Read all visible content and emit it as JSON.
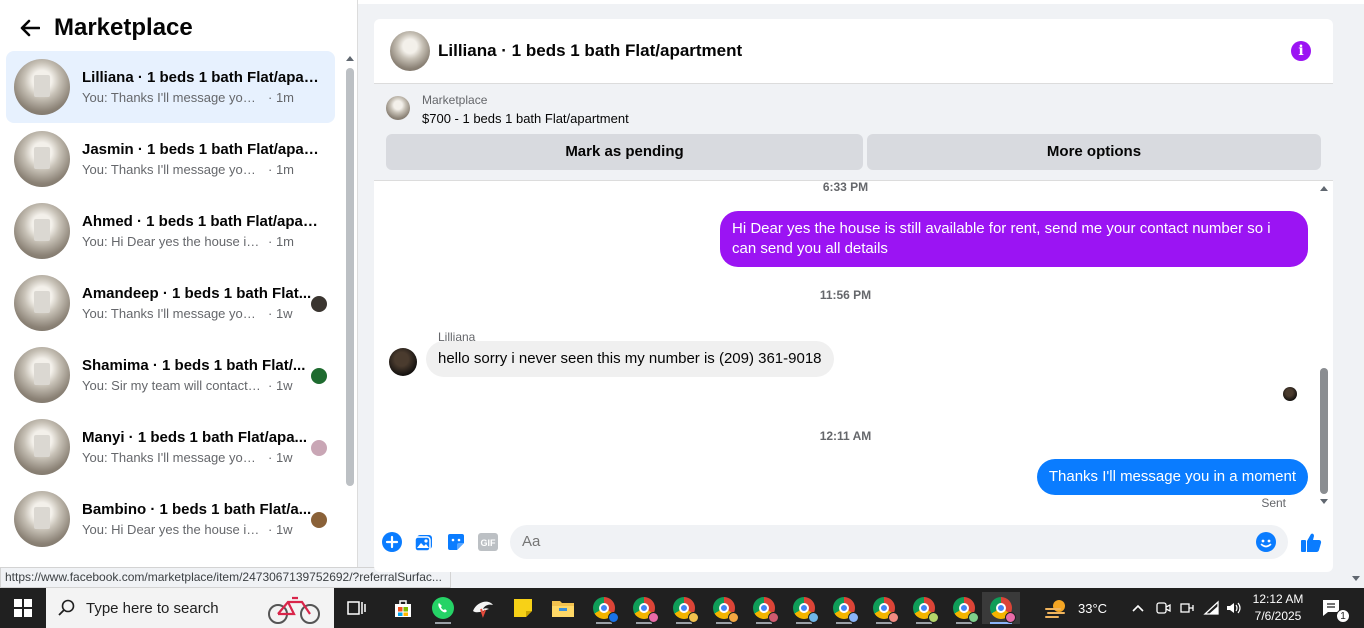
{
  "left_panel": {
    "title": "Marketplace",
    "conversations": [
      {
        "name": "Lilliana · 1 beds 1 bath Flat/apart...",
        "preview": "You: Thanks I'll message you in a ...",
        "time": "· 1m",
        "active": true,
        "mini_color": ""
      },
      {
        "name": "Jasmin · 1 beds 1 bath Flat/apart...",
        "preview": "You: Thanks I'll message you in a ...",
        "time": "· 1m",
        "active": false,
        "mini_color": ""
      },
      {
        "name": "Ahmed · 1 beds 1 bath Flat/apart...",
        "preview": "You: Hi Dear yes the house is still a...",
        "time": "· 1m",
        "active": false,
        "mini_color": ""
      },
      {
        "name": "Amandeep · 1 beds 1 bath Flat...",
        "preview": "You: Thanks I'll message you in ...",
        "time": "· 1w",
        "active": false,
        "mini_color": "#3a3530"
      },
      {
        "name": "Shamima · 1 beds 1 bath Flat/...",
        "preview": "You: Sir my team will contact yo...",
        "time": "· 1w",
        "active": false,
        "mini_color": "#1e6b2f"
      },
      {
        "name": "Manyi · 1 beds 1 bath Flat/apa...",
        "preview": "You: Thanks I'll message you in ...",
        "time": "· 1w",
        "active": false,
        "mini_color": "#c9a6b5"
      },
      {
        "name": "Bambino · 1 beds 1 bath Flat/a...",
        "preview": "You: Hi Dear yes the house is stil...",
        "time": "· 1w",
        "active": false,
        "mini_color": "#8a6138"
      }
    ]
  },
  "status_url": "https://www.facebook.com/marketplace/item/2473067139752692/?referralSurfac...",
  "chat": {
    "title": "Lilliana · 1 beds 1 bath Flat/apartment",
    "marketplace_label": "Marketplace",
    "listing": "$700 - 1 beds 1 bath Flat/apartment",
    "mark_pending": "Mark as pending",
    "more_options": "More options",
    "messages": {
      "ts1": "6:33 PM",
      "msg1": "Hi Dear yes the house is still available for rent, send me your contact number so i can send you all details",
      "ts2": "11:56 PM",
      "sender": "Lilliana",
      "msg2": "hello sorry i never seen this my number is (209) 361-9018",
      "ts3": "12:11 AM",
      "msg3": "Thanks I'll message you in a moment",
      "sent": "Sent"
    },
    "composer_placeholder": "Aa"
  },
  "taskbar": {
    "search_placeholder": "Type here to search",
    "weather": "33°C",
    "time": "12:12 AM",
    "date": "7/6/2025",
    "notifications": "1"
  },
  "colors": {
    "accent_purple": "#9b14f3",
    "accent_blue": "#0a7cff"
  }
}
